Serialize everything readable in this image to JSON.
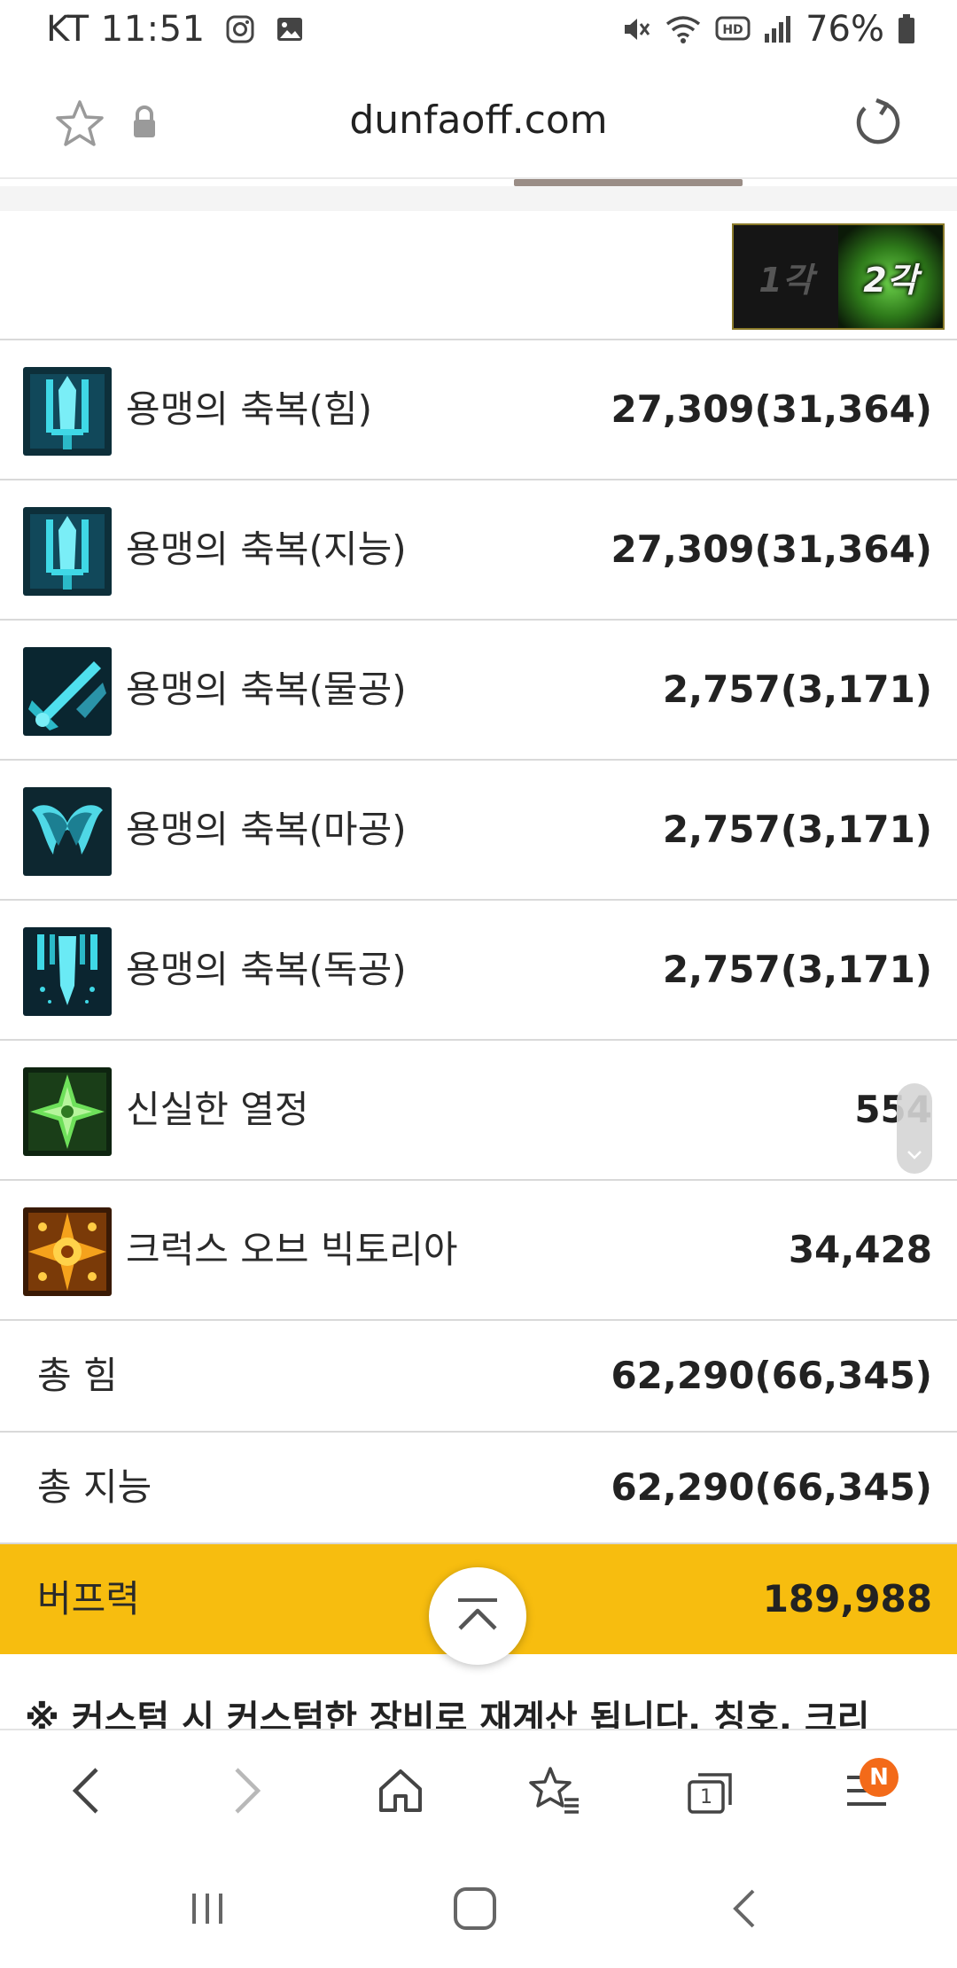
{
  "status_bar": {
    "carrier_time": "KT 11:51",
    "battery_percent": "76%",
    "icons": [
      "instagram-icon",
      "gallery-icon",
      "mute-icon",
      "wifi-icon",
      "hd-icon",
      "signal-icon",
      "battery-icon"
    ]
  },
  "url_bar": {
    "url": "dunfaoff.com",
    "icons": [
      "star-icon",
      "lock-icon",
      "reload-icon"
    ]
  },
  "awakening": {
    "first_label": "1각",
    "second_label": "2각"
  },
  "buffs": [
    {
      "name": "용맹의 축복(힘)",
      "value": "27,309(31,364)",
      "icon": "sword-buff-icon"
    },
    {
      "name": "용맹의 축복(지능)",
      "value": "27,309(31,364)",
      "icon": "sword-buff-icon"
    },
    {
      "name": "용맹의 축복(물공)",
      "value": "2,757(3,171)",
      "icon": "crossed-sword-icon"
    },
    {
      "name": "용맹의 축복(마공)",
      "value": "2,757(3,171)",
      "icon": "wings-icon"
    },
    {
      "name": "용맹의 축복(독공)",
      "value": "2,757(3,171)",
      "icon": "spear-buff-icon"
    },
    {
      "name": "신실한 열정",
      "value": "554",
      "icon": "green-cross-icon"
    },
    {
      "name": "크럭스 오브 빅토리아",
      "value": "34,428",
      "icon": "golden-cross-icon"
    }
  ],
  "totals": [
    {
      "name": "총 힘",
      "value": "62,290(66,345)"
    },
    {
      "name": "총 지능",
      "value": "62,290(66,345)"
    }
  ],
  "buff_power": {
    "name": "버프력",
    "value": "189,988"
  },
  "note": "※ 커스텀 시 커스텀한 장비로 재계산 됩니다. 칭호, 크리",
  "toolbar": {
    "badge": "N",
    "icons": [
      "back-icon",
      "forward-icon",
      "home-icon",
      "bookmarks-icon",
      "tabs-icon",
      "menu-icon"
    ],
    "tab_count": "1"
  },
  "colors": {
    "buff_power_bg": "#f7bd0f",
    "badge": "#f36a19",
    "icon_cyan": "#3fd8e6"
  }
}
